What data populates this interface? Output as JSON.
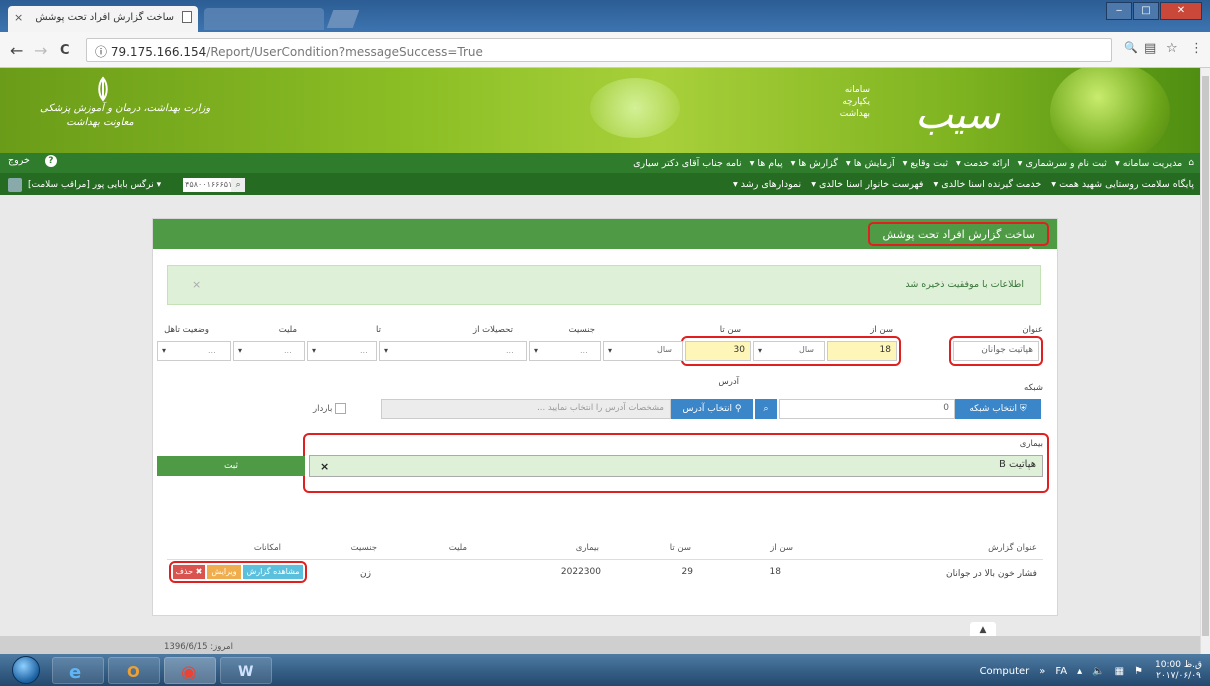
{
  "browser": {
    "tab_title": "ساخت گزارش افراد تحت پوشش",
    "url_host": "79.175.166.154",
    "url_path": "/Report/UserCondition?messageSuccess=True",
    "close_glyph": "×",
    "back_glyph": "←",
    "forward_glyph": "→",
    "reload_glyph": "C",
    "info_glyph": "ⓘ",
    "zoom_glyph": "🔍",
    "star_glyph": "☆",
    "menu_glyph": "⋮"
  },
  "header": {
    "logo_text": "سیب",
    "subtitle": "سامانه\nیکپارچه\nبهداشت",
    "ministry": "وزارت بهداشت، درمان و آموزش پزشکی\nمعاونت بهداشت"
  },
  "mainnav": {
    "home_icon": "home-icon",
    "items": [
      "مدیریت سامانه ▾",
      "ثبت نام و سرشماری ▾",
      "ارائه خدمت ▾",
      "ثبت وقایع ▾",
      "آزمایش ها ▾",
      "گزارش ها ▾",
      "پیام ها ▾",
      "نامه جناب آقای دکتر سیاری"
    ],
    "exit_label": "خروج",
    "help_glyph": "?"
  },
  "subnav": {
    "items": [
      "پایگاه سلامت روستایی شهید همت ▾",
      "خدمت گیرنده اسنا خالدی ▾",
      "فهرست خانوار اسنا خالدی ▾",
      "نمودارهای رشد ▾"
    ],
    "user_name": "نرگس بابایی پور [مراقب سلامت] ▾",
    "national_code": "۴۵۸۰۰۱۶۶۶۵۱"
  },
  "panel": {
    "title": "ساخت گزارش افراد تحت پوشش",
    "alert_text": "اطلاعات با موفقیت ذخیره شد",
    "alert_close": "×",
    "labels": {
      "title": "عنوان",
      "age_from": "سن از",
      "age_to": "سن تا",
      "gender": "جنسیت",
      "education_from": "تحصیلات از",
      "to": "تا",
      "nationality": "ملیت",
      "marital": "وضعیت تاهل",
      "network": "شبکه",
      "address": "آدرس",
      "disease": "بیماری"
    },
    "values": {
      "title": "هپاتیت جوانان",
      "age_from": "18",
      "age_from_unit": "سال",
      "age_to": "30",
      "age_to_unit": "سال",
      "network": "0",
      "dots": "...",
      "caret": "▾"
    },
    "buttons": {
      "select_network": "انتخاب شبکه",
      "select_address": "انتخاب آدرس",
      "submit": "ثبت"
    },
    "address_placeholder": "مشخصات آدرس را انتخاب نمایید ...",
    "pregnant_label": "باردار",
    "disease_tag": "هپاتیت B",
    "tag_remove": "×"
  },
  "table": {
    "headers": [
      "عنوان گزارش",
      "سن از",
      "سن تا",
      "بیماری",
      "ملیت",
      "جنسیت",
      "امکانات"
    ],
    "rows": [
      {
        "title": "فشار خون بالا در جوانان",
        "age_from": "18",
        "age_to": "29",
        "disease": "2022300",
        "nationality": "",
        "gender": "زن",
        "actions": {
          "view": "مشاهده گزارش",
          "edit": "ویرایش",
          "delete": "✖ حذف"
        }
      }
    ]
  },
  "footer": {
    "date": "امروز: 1396/6/15",
    "scroll_top": "▲"
  },
  "taskbar": {
    "computer_label": "Computer",
    "lang": "FA",
    "chevrons": "»",
    "clock_time": "10:00 ق.ظ",
    "clock_date": "۲۰۱۷/۰۶/۰۹"
  },
  "colors": {
    "accent_green": "#4f9a45",
    "highlight_red": "#e02020",
    "alert_bg": "#dff0d8",
    "highlight_yellow": "#fdf6b8"
  }
}
